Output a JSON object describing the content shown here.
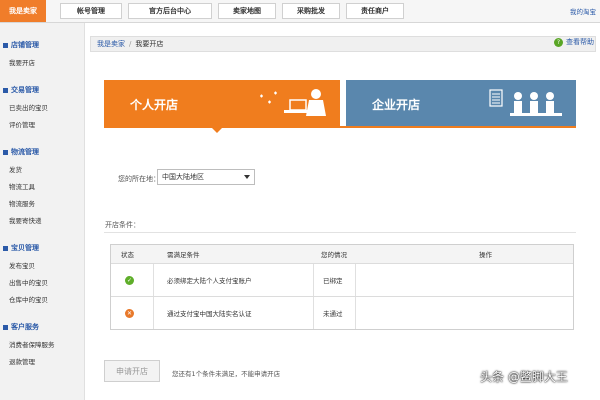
{
  "topbar": {
    "brand": "我是卖家",
    "tabs": [
      "帐号管理",
      "官方后台中心",
      "卖家地图",
      "采购批发",
      "责任商户"
    ],
    "right_link": "我的淘宝"
  },
  "sidebar": {
    "sections": [
      {
        "title": "店铺管理",
        "items": [
          "我要开店"
        ]
      },
      {
        "title": "交易管理",
        "items": [
          "已卖出的宝贝",
          "评价管理"
        ]
      },
      {
        "title": "物流管理",
        "items": [
          "发货",
          "物流工具",
          "物流服务",
          "我要寄快递"
        ]
      },
      {
        "title": "宝贝管理",
        "items": [
          "发布宝贝",
          "出售中的宝贝",
          "仓库中的宝贝"
        ]
      },
      {
        "title": "客户服务",
        "items": [
          "消费者保障服务",
          "退款管理"
        ]
      }
    ]
  },
  "breadcrumb": {
    "root": "我是卖家",
    "current": "我要开店"
  },
  "help_link": "查看帮助",
  "tabs": {
    "personal": "个人开店",
    "enterprise": "企业开店"
  },
  "location": {
    "label": "您的所在地：",
    "value": "中国大陆地区"
  },
  "conditions": {
    "label": "开店条件：",
    "headers": [
      "状态",
      "需满足条件",
      "您的情况",
      "操作"
    ],
    "rows": [
      {
        "condition": "必须绑定大陆个人支付宝账户",
        "situation": "已绑定",
        "status": "ok"
      },
      {
        "condition": "通过支付宝中国大陆实名认证",
        "situation": "未通过",
        "status": "fail"
      }
    ]
  },
  "apply_button": "申请开店",
  "note": "您还有1个条件未满足，不能申请开店",
  "watermark": "头条 @鳖脚大王",
  "colors": {
    "accent": "#f07d1e",
    "blue_panel": "#5a87ad",
    "link": "#2b5aa8"
  }
}
